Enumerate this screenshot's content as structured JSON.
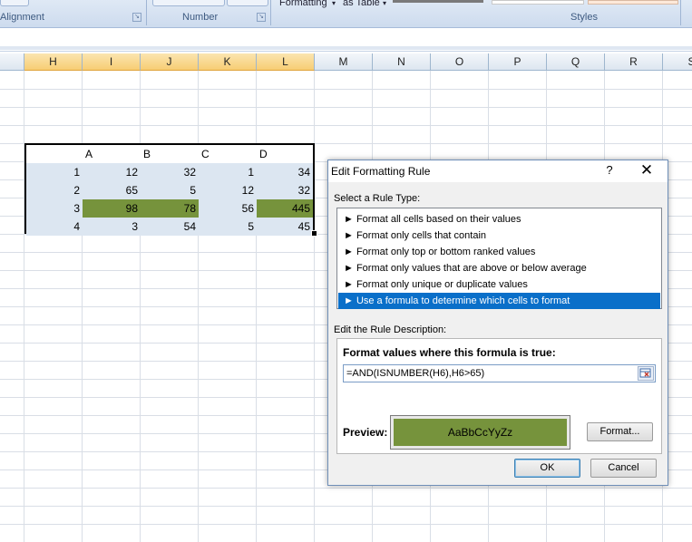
{
  "ribbon": {
    "groups": [
      {
        "label": "Alignment"
      },
      {
        "label": "Number"
      },
      {
        "label": "Styles"
      }
    ],
    "formatting_label": "Formatting",
    "as_table_label": "as Table"
  },
  "columns": [
    "H",
    "I",
    "J",
    "K",
    "L",
    "M",
    "N",
    "O",
    "P",
    "Q",
    "R",
    "S"
  ],
  "table": {
    "headers": [
      "A",
      "B",
      "C",
      "D"
    ],
    "rows": [
      {
        "id": "1",
        "values": [
          "12",
          "32",
          "1",
          "34"
        ]
      },
      {
        "id": "2",
        "values": [
          "65",
          "5",
          "12",
          "32"
        ]
      },
      {
        "id": "3",
        "values": [
          "98",
          "78",
          "56",
          "445"
        ]
      },
      {
        "id": "4",
        "values": [
          "3",
          "54",
          "5",
          "45"
        ]
      }
    ]
  },
  "dialog": {
    "title": "Edit Formatting Rule",
    "help": "?",
    "close": "✕",
    "select_rule_label": "Select a Rule Type:",
    "rules": [
      "► Format all cells based on their values",
      "► Format only cells that contain",
      "► Format only top or bottom ranked values",
      "► Format only values that are above or below average",
      "► Format only unique or duplicate values",
      "► Use a formula to determine which cells to format"
    ],
    "selected_rule_index": 5,
    "edit_desc_label": "Edit the Rule Description:",
    "formula_label": "Format values where this formula is true:",
    "formula_value": "=AND(ISNUMBER(H6),H6>65)",
    "preview_label": "Preview:",
    "preview_text": "AaBbCcYyZz",
    "format_button": "Format...",
    "ok_button": "OK",
    "cancel_button": "Cancel"
  },
  "colors": {
    "highlight_fill": "#76933c",
    "selection_blue": "#0a6fc9"
  }
}
